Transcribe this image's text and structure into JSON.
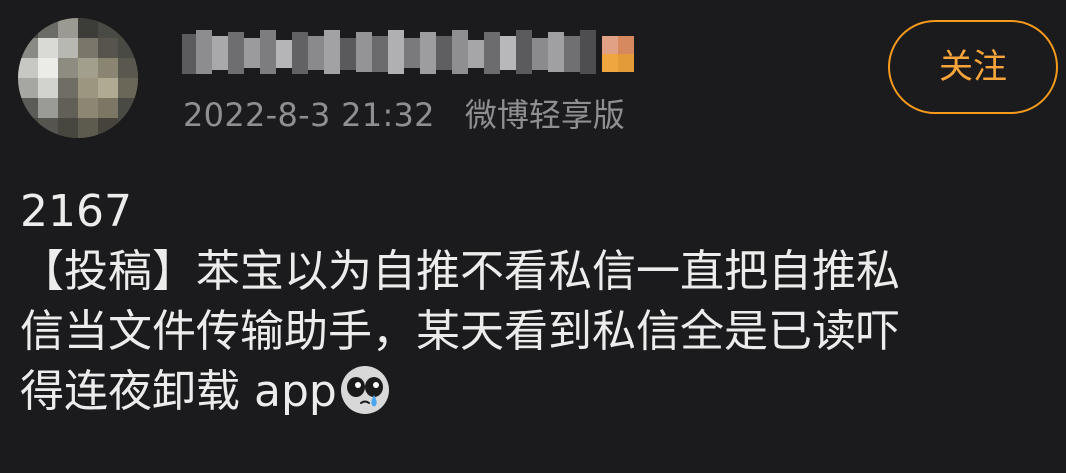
{
  "post": {
    "meta": {
      "time": "2022-8-3 21:32",
      "source": "微博轻享版"
    },
    "follow_label": "关注",
    "content": {
      "lines": [
        "2167",
        "【投稿】苯宝以为自推不看私信一直把自推私",
        "信当文件传输助手，某天看到私信全是已读吓",
        "得连夜卸载 app"
      ],
      "emoji": "crying-face-icon"
    }
  },
  "colors": {
    "background": "#1b1b1d",
    "accent": "#f59a1c",
    "text": "#ececec",
    "muted": "#8f8f93"
  }
}
